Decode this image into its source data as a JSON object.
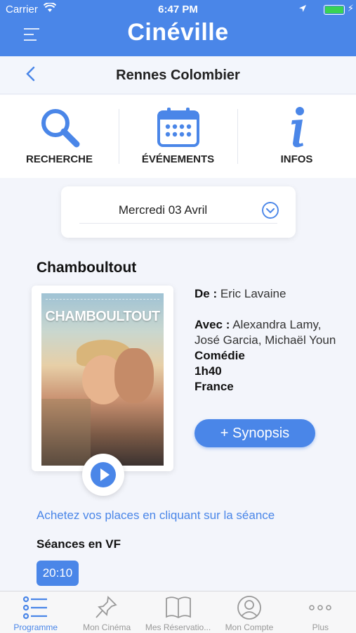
{
  "status_bar": {
    "carrier": "Carrier",
    "time": "6:47 PM"
  },
  "header": {
    "logo_text": "Cinéville"
  },
  "titlebar": {
    "title": "Rennes Colombier"
  },
  "shortcuts": [
    {
      "label": "RECHERCHE",
      "icon": "search-icon"
    },
    {
      "label": "ÉVÉNEMENTS",
      "icon": "calendar-icon"
    },
    {
      "label": "INFOS",
      "icon": "info-icon"
    }
  ],
  "date_selector": {
    "value": "Mercredi 03 Avril"
  },
  "film": {
    "title": "Chamboultout",
    "poster_title": "CHAMBOULTOUT",
    "director_label": "De :",
    "director": "Eric Lavaine",
    "cast_label": "Avec :",
    "cast": "Alexandra Lamy, José Garcia, Michaël Youn",
    "genre": "Comédie",
    "duration": "1h40",
    "country": "France",
    "synopsis_label": "+ Synopsis"
  },
  "booking": {
    "hint": "Achetez vos places en cliquant sur la séance",
    "section_title": "Séances en VF",
    "times": [
      "20:10"
    ]
  },
  "tabbar": [
    {
      "label": "Programme",
      "icon": "list-icon",
      "active": true
    },
    {
      "label": "Mon Cinéma",
      "icon": "pin-icon",
      "active": false
    },
    {
      "label": "Mes Réservatio...",
      "icon": "book-icon",
      "active": false
    },
    {
      "label": "Mon Compte",
      "icon": "user-icon",
      "active": false
    },
    {
      "label": "Plus",
      "icon": "more-icon",
      "active": false
    }
  ],
  "colors": {
    "accent": "#4a86e8",
    "battery": "#39d353"
  }
}
